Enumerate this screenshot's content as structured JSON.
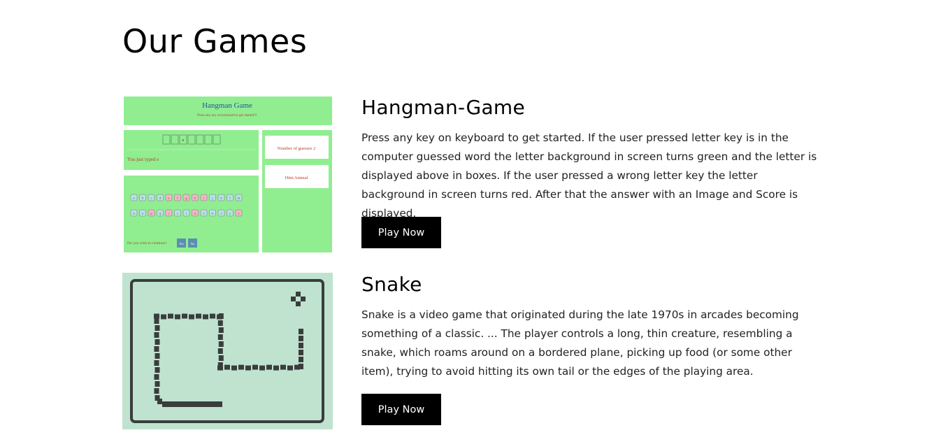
{
  "page": {
    "title": "Our Games"
  },
  "games": [
    {
      "title": "Hangman-Game",
      "description": "Press any key on keyboard to get started. If the user pressed letter key is in the computer guessed word the letter background in screen turns green and the letter is displayed above in boxes. If the user pressed a wrong letter key the letter background in screen turns red. After that the answer with an Image and Score is displayed.",
      "button_label": "Play Now",
      "thumbnail": {
        "heading": "Hangman Game",
        "subheading": "Press any key on keyboard to get started!!!",
        "typed_text": "You just typed e",
        "guesses_text": "Number of guesses 2",
        "hint_text": "Hint:Animal",
        "continue_text": "Do you wish to continue?",
        "yes_label": "Yes",
        "no_label": "No",
        "word_boxes": [
          "",
          "",
          "e",
          "",
          "",
          "",
          ""
        ],
        "keys_row1": [
          "a",
          "b",
          "c",
          "d",
          "e",
          "f",
          "g",
          "h",
          "i",
          "j",
          "k",
          "l",
          "m"
        ],
        "keys_row2": [
          "n",
          "o",
          "p",
          "q",
          "r",
          "s",
          "t",
          "u",
          "v",
          "w",
          "x",
          "y",
          "z"
        ],
        "bg_color": "#90ee90"
      }
    },
    {
      "title": "Snake",
      "description": "Snake is a video game that originated during the late 1970s in arcades becoming something of a classic. ... The player controls a long, thin creature, resembling a snake, which roams around on a bordered plane, picking up food (or some other item), trying to avoid hitting its own tail or the edges of the playing area.",
      "button_label": "Play Now",
      "thumbnail": {
        "bg_color": "#bfe3cf",
        "snake_color": "#3a3d3c"
      }
    }
  ]
}
